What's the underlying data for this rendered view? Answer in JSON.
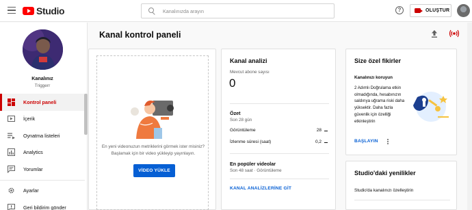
{
  "app": {
    "logo_text": "Studio"
  },
  "search": {
    "placeholder": "Kanalınızda arayın"
  },
  "header": {
    "create_label": "OLUŞTUR",
    "help_icon": "?"
  },
  "sidebar": {
    "channel_title": "Kanalınız",
    "channel_subtitle": "Triggerr",
    "items": [
      {
        "label": "Kontrol paneli",
        "icon": "dashboard-icon",
        "active": true
      },
      {
        "label": "İçerik",
        "icon": "content-icon"
      },
      {
        "label": "Oynatma listeleri",
        "icon": "playlist-icon"
      },
      {
        "label": "Analytics",
        "icon": "analytics-icon"
      },
      {
        "label": "Yorumlar",
        "icon": "comments-icon"
      },
      {
        "label": "Ayarlar",
        "icon": "gear-icon"
      },
      {
        "label": "Geri bildirim gönder",
        "icon": "feedback-icon"
      }
    ]
  },
  "page": {
    "title": "Kanal kontrol paneli"
  },
  "upload_card": {
    "prompt_line1": "En yeni videonuzun metriklerini görmek ister misiniz?",
    "prompt_line2": "Başlamak için bir video yükleyip yayınlayın.",
    "button_label": "VİDEO YÜKLE"
  },
  "analytics_card": {
    "title": "Kanal analizi",
    "subscribers_label": "Mevcut abone sayısı",
    "subscribers_value": "0",
    "summary_title": "Özet",
    "summary_period": "Son 28 gün",
    "rows": [
      {
        "label": "Görüntüleme",
        "value": "28"
      },
      {
        "label": "İzlenme süresi (saat)",
        "value": "0,2"
      }
    ],
    "popular_title": "En popüler videolar",
    "popular_subtitle": "Son 48 saat · Görüntüleme",
    "link_label": "KANAL ANALİZLERİNE GİT"
  },
  "ideas_card": {
    "title": "Size özel fikirler",
    "subtitle": "Kanalınızı koruyun",
    "body": "2 Adımlı Doğrulama etkin olmadığında, hesabınızın saldırıya uğrama riski daha yüksektir. Daha fazla güvenlik için özelliği etkinleştirin",
    "action_label": "BAŞLAYIN"
  },
  "news_card": {
    "title": "Studio'daki yenilikler",
    "item1": "Studio'da kanalınızı özelleştirin"
  },
  "colors": {
    "accent": "#cc0000",
    "link": "#065fd4",
    "logo": "#ff0000"
  }
}
